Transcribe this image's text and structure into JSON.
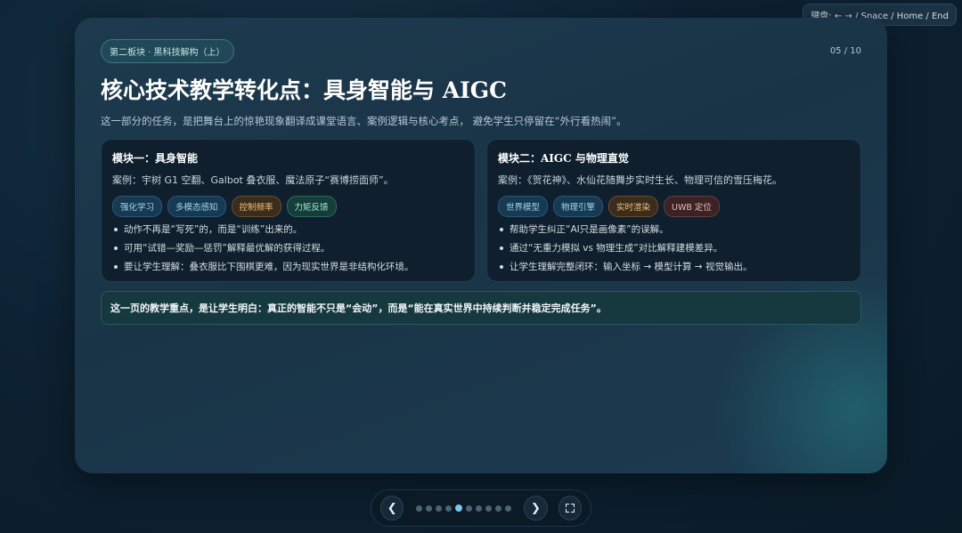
{
  "keyboard_hint": "键盘: ← → / Space / Home / End",
  "slide": {
    "section_tag": "第二板块 · 黑科技解构（上）",
    "page_number": "05 / 10",
    "title": "核心技术教学转化点：具身智能与 AIGC",
    "subtitle": "这一部分的任务，是把舞台上的惊艳现象翻译成课堂语言、案例逻辑与核心考点， 避免学生只停留在“外行看热闹”。",
    "cards": [
      {
        "title": "模块一：具身智能",
        "case": "案例：宇树 G1 空翻、Galbot 叠衣服、魔法原子“赛博捞面师”。",
        "chips": [
          "强化学习",
          "多模态感知",
          "控制频率",
          "力矩反馈"
        ],
        "bullets": [
          "动作不再是“写死”的，而是“训练”出来的。",
          "可用“试错—奖励—惩罚”解释最优解的获得过程。",
          "要让学生理解：叠衣服比下围棋更难，因为现实世界是非结构化环境。"
        ]
      },
      {
        "title": "模块二：AIGC 与物理直觉",
        "case": "案例：《贺花神》、水仙花随舞步实时生长、物理可信的雪压梅花。",
        "chips": [
          "世界模型",
          "物理引擎",
          "实时渲染",
          "UWB 定位"
        ],
        "bullets": [
          "帮助学生纠正“AI只是画像素”的误解。",
          "通过“无重力模拟 vs 物理生成”对比解释建模差异。",
          "让学生理解完整闭环：输入坐标 → 模型计算 → 视觉输出。"
        ]
      }
    ],
    "callout": "这一页的教学重点，是让学生明白：真正的智能不只是“会动”，而是“能在真实世界中持续判断并稳定完成任务”。"
  },
  "nav": {
    "prev_symbol": "❮",
    "next_symbol": "❯",
    "total_pages": 10,
    "current_page": 5
  },
  "colors": {
    "accent": "#7cc7ea",
    "chip_blue": "#9fd6f2",
    "chip_orange": "#f3c27d",
    "chip_teal": "#9ff0d8",
    "chip_pink": "#f2b9b2"
  },
  "icons": {
    "prev": "chevron-left-icon",
    "next": "chevron-right-icon",
    "fullscreen": "fullscreen-icon"
  }
}
